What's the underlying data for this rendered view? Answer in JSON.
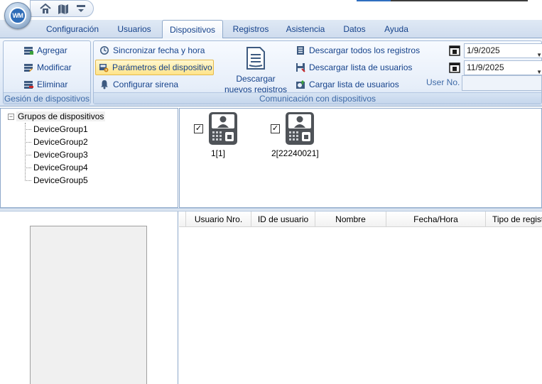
{
  "app": {
    "logo_text": "WM",
    "quick_access": [
      "home-icon",
      "map-icon",
      "dropdown-icon"
    ]
  },
  "tabs": [
    {
      "label": "Configuración",
      "active": false
    },
    {
      "label": "Usuarios",
      "active": false
    },
    {
      "label": "Dispositivos",
      "active": true
    },
    {
      "label": "Registros",
      "active": false
    },
    {
      "label": "Asistencia",
      "active": false
    },
    {
      "label": "Datos",
      "active": false
    },
    {
      "label": "Ayuda",
      "active": false
    }
  ],
  "ribbon": {
    "gestion": {
      "label": "Gesión de dispositivos",
      "buttons": [
        "Agregar",
        "Modificar",
        "Eliminar"
      ]
    },
    "comunicacion": {
      "label": "Comunicación con dispositivos",
      "col1": [
        "Sincronizar fecha y hora",
        "Parámetros del dispositivo",
        "Configurar sirena"
      ],
      "big_button": [
        "Descargar",
        "nuevos registros"
      ],
      "col2": [
        "Descargar todos los registros",
        "Descargar lista de usuarios",
        "Cargar lista de usuarios"
      ],
      "start_date": "1/9/2025",
      "end_date": "11/9/2025",
      "user_no_label": "User No.",
      "user_no_value": ""
    }
  },
  "tree": {
    "root": "Grupos de dispositivos",
    "expander": "−",
    "items": [
      "DeviceGroup1",
      "DeviceGroup2",
      "DeviceGroup3",
      "DeviceGroup4",
      "DeviceGroup5"
    ]
  },
  "devices": [
    {
      "label": "1[1]",
      "checked": true
    },
    {
      "label": "2[22240021]",
      "checked": true
    }
  ],
  "grid": {
    "columns": [
      "Usuario Nro.",
      "ID de usuario",
      "Nombre",
      "Fecha/Hora",
      "Tipo de registro"
    ]
  },
  "colors": {
    "accent": "#15428b",
    "ribbon_bg": "#e3ecf8",
    "highlight": "#ffe48a"
  }
}
